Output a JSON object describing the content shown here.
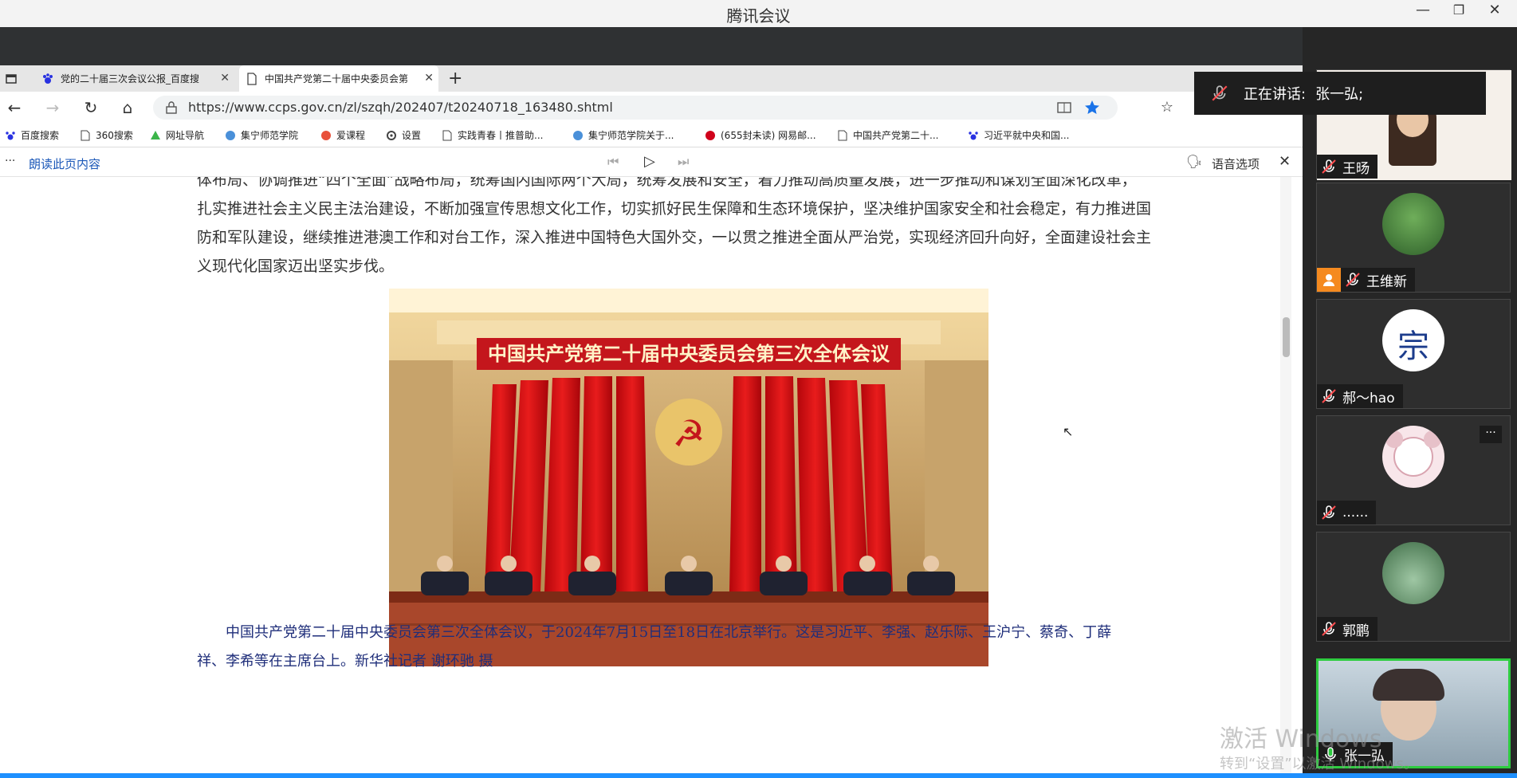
{
  "app": {
    "title": "腾讯会议",
    "minimize": "—",
    "restore": "❐",
    "close": "✕"
  },
  "browser": {
    "tabs": [
      {
        "label": "党的二十届三次会议公报_百度搜",
        "close": "✕"
      },
      {
        "label": "中国共产党第二十届中央委员会第",
        "close": "✕"
      }
    ],
    "new_tab": "+",
    "url": "https://www.ccps.gov.cn/zl/szqh/202407/t20240718_163480.shtml",
    "bookmarks": [
      "百度搜索",
      "360搜索",
      "网址导航",
      "集宁师范学院",
      "爱课程",
      "设置",
      "实践青春丨推普助...",
      "集宁师范学院关于...",
      "(655封未读) 网易邮...",
      "中国共产党第二十...",
      "习近平就中央和国..."
    ],
    "readbar": {
      "read_aloud": "朗读此页内容",
      "voice_options": "语音选项"
    }
  },
  "article": {
    "paragraph_lines": [
      "体布局、协调推进“四个全面”战略布局，统筹国内国际两个大局，统筹发展和安全，着力推动高质量发展，进一步推动和谋划全面深化改革，",
      "扎实推进社会主义民主法治建设，不断加强宣传思想文化工作，切实抓好民生保障和生态环境保护，坚决维护国家安全和社会稳定，有力推进国",
      "防和军队建设，继续推进港澳工作和对台工作，深入推进中国特色大国外交，一以贯之推进全面从严治党，实现经济回升向好，全面建设社会主",
      "义现代化国家迈出坚实步伐。"
    ],
    "photo_banner": "中国共产党第二十届中央委员会第三次全体会议",
    "caption_lines": [
      "中国共产党第二十届中央委员会第三次全体会议，于2024年7月15日至18日在北京举行。这是习近平、李强、赵乐际、王沪宁、蔡奇、丁薛",
      "祥、李希等在主席台上。新华社记者 谢环驰 摄"
    ]
  },
  "meeting": {
    "speaking_label": "正在讲话:",
    "speaking_name": "张一弘;",
    "participants": [
      {
        "name": "王旸",
        "muted": true
      },
      {
        "name": "王维新",
        "muted": true
      },
      {
        "name": "郝～hao",
        "muted": true
      },
      {
        "name": "......",
        "muted": true
      },
      {
        "name": "郭鹏",
        "muted": true
      },
      {
        "name": "张一弘",
        "muted": false
      }
    ],
    "more_options": "···"
  },
  "watermark": {
    "line1": "激活 Windows",
    "line2": "转到“设置”以激活 Windows。"
  },
  "colors": {
    "accent": "#1a73e8",
    "meeting_bg": "#262626",
    "active_speaker_border": "#2ecc40",
    "caption": "#1f2e7a"
  }
}
